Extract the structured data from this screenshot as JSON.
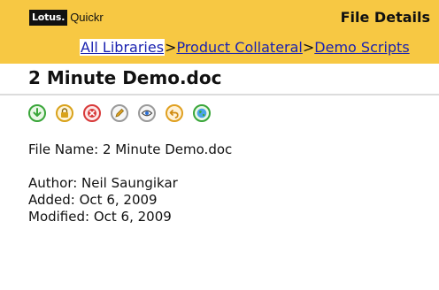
{
  "header": {
    "brand_lotus": "Lotus.",
    "brand_quickr": "Quickr",
    "page_title": "File Details"
  },
  "breadcrumb": {
    "items": [
      "All Libraries",
      "Product Collateral",
      "Demo Scripts"
    ],
    "separator": ">"
  },
  "document": {
    "title": "2 Minute Demo.doc"
  },
  "toolbar": {
    "icons": [
      {
        "name": "download-icon",
        "color": "#3aa63a"
      },
      {
        "name": "lock-icon",
        "color": "#d9a21a"
      },
      {
        "name": "delete-icon",
        "color": "#d83a3a"
      },
      {
        "name": "edit-icon",
        "color": "#e0a020"
      },
      {
        "name": "view-icon",
        "color": "#4a4a4a"
      },
      {
        "name": "undo-icon",
        "color": "#e0a020"
      },
      {
        "name": "globe-icon",
        "color": "#3aa63a"
      }
    ]
  },
  "details": {
    "file_name": "File Name: 2 Minute Demo.doc",
    "author": "Author: Neil Saungikar",
    "added": "Added: Oct 6, 2009",
    "modified": "Modified: Oct 6, 2009"
  },
  "colors": {
    "header_bg": "#f7c843",
    "link": "#1a22b0"
  }
}
